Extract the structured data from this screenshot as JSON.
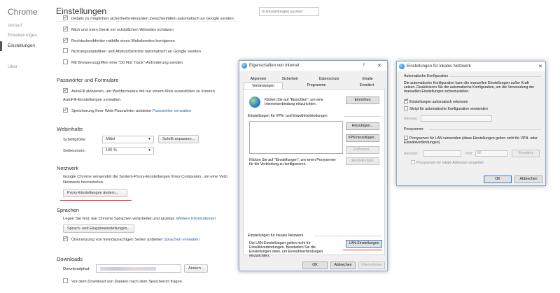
{
  "sidebar": {
    "brand": "Chrome",
    "items": [
      {
        "label": "Verlauf"
      },
      {
        "label": "Erweiterungen"
      },
      {
        "label": "Einstellungen"
      },
      {
        "label": "Über"
      }
    ]
  },
  "header": {
    "title": "Einstellungen",
    "search_placeholder": "In Einstellungen suchen"
  },
  "privacy": {
    "cut_option": "Details zu möglichen sicherheitsrelevanten Zwischenfällen automatisch an Google senden",
    "opt1": "Mich und mein Gerät vor schädlichen Websites schützen",
    "opt2": "Rechtschreibfehler mithilfe eines Webdienstes korrigieren",
    "opt3": "Nutzungsstatistiken und Absturzberichte automatisch an Google senden",
    "opt4": "Mit Browserzugriffen eine \"Do Not Track\"-Anforderung senden"
  },
  "passwords": {
    "title": "Passwörter und Formulare",
    "autofill": "AutoFill aktivieren, um Webformulare mit nur einem Klick auszufüllen zu können",
    "autofill_link": "AutoFill-Einstellungen verwalten",
    "save_pw": "Speicherung Ihrer Web-Passwörter anbieten",
    "save_pw_link": "Passwörter verwalten"
  },
  "web_content": {
    "title": "Webinhalte",
    "font_size_label": "Schriftgröße:",
    "font_size_value": "Mittel",
    "custom_fonts_button": "Schrift anpassen...",
    "zoom_label": "Seitenzoom:",
    "zoom_value": "100 %"
  },
  "network": {
    "title": "Netzwerk",
    "description_line1": "Google Chrome verwendet die System-Proxy-Einstellungen Ihres Computers, um eine Verb",
    "description_line2": "Netzwerk herzustellen.",
    "proxy_button": "Proxy-Einstellungen ändern..."
  },
  "languages": {
    "title": "Sprachen",
    "description": "Legen Sie fest, wie Chrome Sprachen verarbeitet und anzeigt.",
    "more_info_link": "Weitere Informationen",
    "input_button": "Sprach- und Eingabeeinstellungen...",
    "translate": "Übersetzung von fremdsprachigen Seiten anbieten",
    "translate_link": "Sprachen verwalten"
  },
  "downloads": {
    "title": "Downloads",
    "path_label": "Downloadpfad:",
    "change_button": "Ändern...",
    "ask_option": "Vor dem Download von Dateien nach dem Speicherort fragen"
  },
  "internet_props": {
    "title": "Eigenschaften von Internet",
    "help_glyph": "?",
    "close_glyph": "✕",
    "tabs_row1": [
      "Allgemein",
      "Sicherheit",
      "Datenschutz",
      "Inhalte"
    ],
    "tabs_row2": [
      "Verbindungen",
      "Programme",
      "Erweitert"
    ],
    "setup_text": "Klicken Sie auf \"Einrichten\", um eine Internetverbindung einzurichten.",
    "setup_button": "Einrichten",
    "vpn_group": "Einstellungen für VPN- und Einwählverbindungen",
    "add_button": "Hinzufügen...",
    "add_vpn_button": "VPN hinzufügen...",
    "remove_button": "Entfernen...",
    "settings_button": "Einstellungen",
    "proxy_text": "Klicken Sie auf \"Einstellungen\", um einen Proxyserver für die Verbindung zu konfigurieren.",
    "lan_group": "Einstellungen für lokales Netzwerk",
    "lan_text": "Die LAN-Einstellungen gelten nicht für Einwählverbindungen. Bearbeiten Sie die Einstellungen oben, um Einwählverbindungen einzurichten.",
    "lan_button": "LAN-Einstellungen",
    "ok": "OK",
    "cancel": "Abbrechen",
    "apply": "Übernehmen"
  },
  "lan_dialog": {
    "title": "Einstellungen für lokales Netzwerk",
    "close_glyph": "✕",
    "auto_group": "Automatische Konfiguration",
    "auto_text": "Die automatische Konfiguration kann die manuellen Einstellungen außer Kraft setzen. Deaktivieren Sie die automatische Konfiguration, um die Verwendung der manuellen Einstellungen sicherzustellen.",
    "auto_detect": "Einstellungen automatisch erkennen",
    "auto_script": "Skript für automatische Konfiguration verwenden",
    "address_label": "Adresse",
    "proxy_group": "Proxyserver",
    "use_proxy": "Proxyserver für LAN verwenden (diese Einstellungen gelten nicht für VPN- oder Einwählverbindungen)",
    "address_label2": "Adresse:",
    "port_label": "Port:",
    "port_value": "80",
    "advanced_button": "Erweitert",
    "bypass_local": "Proxyserver für lokale Adressen umgehen",
    "ok": "OK",
    "cancel": "Abbrechen"
  }
}
